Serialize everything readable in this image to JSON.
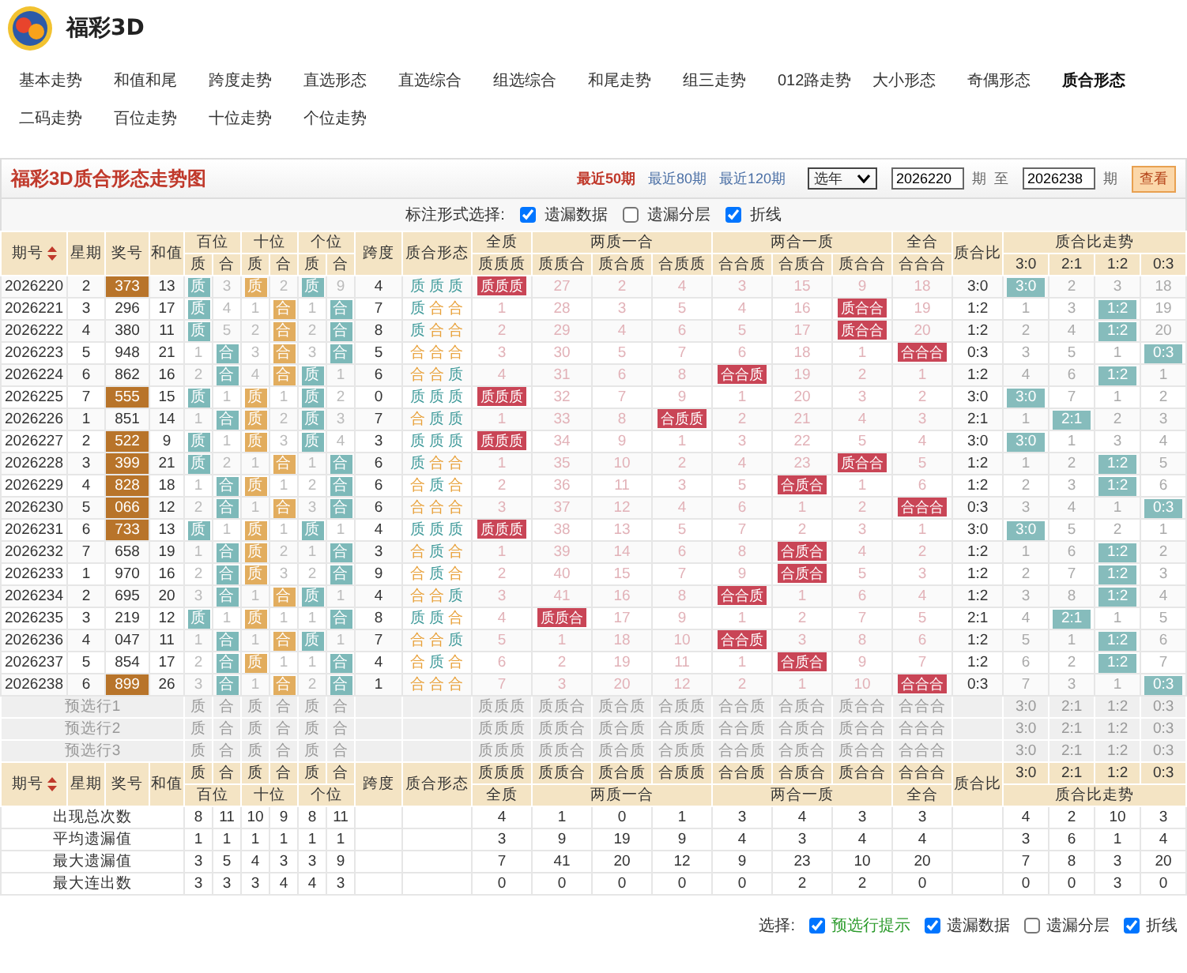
{
  "site": {
    "title": "福彩3D"
  },
  "nav": [
    {
      "label": "基本走势",
      "selected": false
    },
    {
      "label": "和值和尾",
      "selected": false
    },
    {
      "label": "跨度走势",
      "selected": false
    },
    {
      "label": "直选形态",
      "selected": false
    },
    {
      "label": "直选综合",
      "selected": false
    },
    {
      "label": "组选综合",
      "selected": false
    },
    {
      "label": "和尾走势",
      "selected": false
    },
    {
      "label": "组三走势",
      "selected": false
    },
    {
      "label": "012路走势",
      "selected": false
    },
    {
      "label": "大小形态",
      "selected": false
    },
    {
      "label": "奇偶形态",
      "selected": false
    },
    {
      "label": "质合形态",
      "selected": true
    },
    {
      "label": "二码走势",
      "selected": false
    },
    {
      "label": "百位走势",
      "selected": false
    },
    {
      "label": "十位走势",
      "selected": false
    },
    {
      "label": "个位走势",
      "selected": false
    }
  ],
  "chart_title": "福彩3D质合形态走势图",
  "period_links": [
    {
      "label": "最近50期",
      "selected": true
    },
    {
      "label": "最近80期",
      "selected": false
    },
    {
      "label": "最近120期",
      "selected": false
    }
  ],
  "year_select": {
    "value": "选年"
  },
  "range": {
    "from": "2026220",
    "from_unit": "期",
    "to_label": "至",
    "to": "2026238",
    "to_unit": "期",
    "button": "查看"
  },
  "marking": {
    "label": "标注形式选择:",
    "options": [
      {
        "label": "遗漏数据",
        "checked": true
      },
      {
        "label": "遗漏分层",
        "checked": false
      },
      {
        "label": "折线",
        "checked": true
      }
    ]
  },
  "header": {
    "basic": [
      "期号",
      "星期",
      "奖号",
      "和值"
    ],
    "digit_groups": [
      {
        "label": "百位",
        "sub": [
          "质",
          "合"
        ]
      },
      {
        "label": "十位",
        "sub": [
          "质",
          "合"
        ]
      },
      {
        "label": "个位",
        "sub": [
          "质",
          "合"
        ]
      }
    ],
    "span_label": "跨度",
    "form_label": "质合形态",
    "form_groups": [
      {
        "label": "全质",
        "sub": [
          "质质质"
        ]
      },
      {
        "label": "两质一合",
        "sub": [
          "质质合",
          "质合质",
          "合质质"
        ]
      },
      {
        "label": "两合一质",
        "sub": [
          "合合质",
          "合质合",
          "质合合"
        ]
      },
      {
        "label": "全合",
        "sub": [
          "合合合"
        ]
      }
    ],
    "ratio_label": "质合比",
    "trend_group": {
      "label": "质合比走势",
      "sub": [
        "3:0",
        "2:1",
        "1:2",
        "0:3"
      ]
    }
  },
  "rows": [
    {
      "period": "2026220",
      "weekday": "2",
      "number": "373",
      "highlighted": true,
      "sum": "13",
      "digits": [
        "质",
        "3",
        "质",
        "2",
        "质",
        "9"
      ],
      "digit_hits": [
        true,
        false,
        true,
        false,
        true,
        false
      ],
      "span": "4",
      "form": [
        {
          "text": "质",
          "color": "#3f9a9a"
        },
        {
          "text": "质",
          "color": "#3f9a9a"
        },
        {
          "text": "质",
          "color": "#3f9a9a"
        }
      ],
      "forms": [
        "质质质",
        "27",
        "2",
        "4",
        "3",
        "15",
        "9",
        "18"
      ],
      "form_hits": [
        true,
        false,
        false,
        false,
        false,
        false,
        false,
        false
      ],
      "ratio": "3:0",
      "trend": [
        "3:0",
        "2",
        "3",
        "18"
      ],
      "trend_hits": [
        true,
        false,
        false,
        false
      ]
    },
    {
      "period": "2026221",
      "weekday": "3",
      "number": "296",
      "highlighted": false,
      "sum": "17",
      "digits": [
        "质",
        "4",
        "1",
        "合",
        "1",
        "合"
      ],
      "digit_hits": [
        true,
        false,
        false,
        true,
        false,
        true
      ],
      "span": "7",
      "form": [
        {
          "text": "质",
          "color": "#3f9a9a"
        },
        {
          "text": "合",
          "color": "#e8a13a"
        },
        {
          "text": "合",
          "color": "#e8a13a"
        }
      ],
      "forms": [
        "1",
        "28",
        "3",
        "5",
        "4",
        "16",
        "质合合",
        "19"
      ],
      "form_hits": [
        false,
        false,
        false,
        false,
        false,
        false,
        true,
        false
      ],
      "ratio": "1:2",
      "trend": [
        "1",
        "3",
        "1:2",
        "19"
      ],
      "trend_hits": [
        false,
        false,
        true,
        false
      ]
    },
    {
      "period": "2026222",
      "weekday": "4",
      "number": "380",
      "highlighted": false,
      "sum": "11",
      "digits": [
        "质",
        "5",
        "2",
        "合",
        "2",
        "合"
      ],
      "digit_hits": [
        true,
        false,
        false,
        true,
        false,
        true
      ],
      "span": "8",
      "form": [
        {
          "text": "质",
          "color": "#3f9a9a"
        },
        {
          "text": "合",
          "color": "#e8a13a"
        },
        {
          "text": "合",
          "color": "#e8a13a"
        }
      ],
      "forms": [
        "2",
        "29",
        "4",
        "6",
        "5",
        "17",
        "质合合",
        "20"
      ],
      "form_hits": [
        false,
        false,
        false,
        false,
        false,
        false,
        true,
        false
      ],
      "ratio": "1:2",
      "trend": [
        "2",
        "4",
        "1:2",
        "20"
      ],
      "trend_hits": [
        false,
        false,
        true,
        false
      ]
    },
    {
      "period": "2026223",
      "weekday": "5",
      "number": "948",
      "highlighted": false,
      "sum": "21",
      "digits": [
        "1",
        "合",
        "3",
        "合",
        "3",
        "合"
      ],
      "digit_hits": [
        false,
        true,
        false,
        true,
        false,
        true
      ],
      "span": "5",
      "form": [
        {
          "text": "合",
          "color": "#e8a13a"
        },
        {
          "text": "合",
          "color": "#e8a13a"
        },
        {
          "text": "合",
          "color": "#e8a13a"
        }
      ],
      "forms": [
        "3",
        "30",
        "5",
        "7",
        "6",
        "18",
        "1",
        "合合合"
      ],
      "form_hits": [
        false,
        false,
        false,
        false,
        false,
        false,
        false,
        true
      ],
      "ratio": "0:3",
      "trend": [
        "3",
        "5",
        "1",
        "0:3"
      ],
      "trend_hits": [
        false,
        false,
        false,
        true
      ]
    },
    {
      "period": "2026224",
      "weekday": "6",
      "number": "862",
      "highlighted": false,
      "sum": "16",
      "digits": [
        "2",
        "合",
        "4",
        "合",
        "质",
        "1"
      ],
      "digit_hits": [
        false,
        true,
        false,
        true,
        true,
        false
      ],
      "span": "6",
      "form": [
        {
          "text": "合",
          "color": "#e8a13a"
        },
        {
          "text": "合",
          "color": "#e8a13a"
        },
        {
          "text": "质",
          "color": "#3f9a9a"
        }
      ],
      "forms": [
        "4",
        "31",
        "6",
        "8",
        "合合质",
        "19",
        "2",
        "1"
      ],
      "form_hits": [
        false,
        false,
        false,
        false,
        true,
        false,
        false,
        false
      ],
      "ratio": "1:2",
      "trend": [
        "4",
        "6",
        "1:2",
        "1"
      ],
      "trend_hits": [
        false,
        false,
        true,
        false
      ]
    },
    {
      "period": "2026225",
      "weekday": "7",
      "number": "555",
      "highlighted": true,
      "sum": "15",
      "digits": [
        "质",
        "1",
        "质",
        "1",
        "质",
        "2"
      ],
      "digit_hits": [
        true,
        false,
        true,
        false,
        true,
        false
      ],
      "span": "0",
      "form": [
        {
          "text": "质",
          "color": "#3f9a9a"
        },
        {
          "text": "质",
          "color": "#3f9a9a"
        },
        {
          "text": "质",
          "color": "#3f9a9a"
        }
      ],
      "forms": [
        "质质质",
        "32",
        "7",
        "9",
        "1",
        "20",
        "3",
        "2"
      ],
      "form_hits": [
        true,
        false,
        false,
        false,
        false,
        false,
        false,
        false
      ],
      "ratio": "3:0",
      "trend": [
        "3:0",
        "7",
        "1",
        "2"
      ],
      "trend_hits": [
        true,
        false,
        false,
        false
      ]
    },
    {
      "period": "2026226",
      "weekday": "1",
      "number": "851",
      "highlighted": false,
      "sum": "14",
      "digits": [
        "1",
        "合",
        "质",
        "2",
        "质",
        "3"
      ],
      "digit_hits": [
        false,
        true,
        true,
        false,
        true,
        false
      ],
      "span": "7",
      "form": [
        {
          "text": "合",
          "color": "#e8a13a"
        },
        {
          "text": "质",
          "color": "#3f9a9a"
        },
        {
          "text": "质",
          "color": "#3f9a9a"
        }
      ],
      "forms": [
        "1",
        "33",
        "8",
        "合质质",
        "2",
        "21",
        "4",
        "3"
      ],
      "form_hits": [
        false,
        false,
        false,
        true,
        false,
        false,
        false,
        false
      ],
      "ratio": "2:1",
      "trend": [
        "1",
        "2:1",
        "2",
        "3"
      ],
      "trend_hits": [
        false,
        true,
        false,
        false
      ]
    },
    {
      "period": "2026227",
      "weekday": "2",
      "number": "522",
      "highlighted": true,
      "sum": "9",
      "digits": [
        "质",
        "1",
        "质",
        "3",
        "质",
        "4"
      ],
      "digit_hits": [
        true,
        false,
        true,
        false,
        true,
        false
      ],
      "span": "3",
      "form": [
        {
          "text": "质",
          "color": "#3f9a9a"
        },
        {
          "text": "质",
          "color": "#3f9a9a"
        },
        {
          "text": "质",
          "color": "#3f9a9a"
        }
      ],
      "forms": [
        "质质质",
        "34",
        "9",
        "1",
        "3",
        "22",
        "5",
        "4"
      ],
      "form_hits": [
        true,
        false,
        false,
        false,
        false,
        false,
        false,
        false
      ],
      "ratio": "3:0",
      "trend": [
        "3:0",
        "1",
        "3",
        "4"
      ],
      "trend_hits": [
        true,
        false,
        false,
        false
      ]
    },
    {
      "period": "2026228",
      "weekday": "3",
      "number": "399",
      "highlighted": true,
      "sum": "21",
      "digits": [
        "质",
        "2",
        "1",
        "合",
        "1",
        "合"
      ],
      "digit_hits": [
        true,
        false,
        false,
        true,
        false,
        true
      ],
      "span": "6",
      "form": [
        {
          "text": "质",
          "color": "#3f9a9a"
        },
        {
          "text": "合",
          "color": "#e8a13a"
        },
        {
          "text": "合",
          "color": "#e8a13a"
        }
      ],
      "forms": [
        "1",
        "35",
        "10",
        "2",
        "4",
        "23",
        "质合合",
        "5"
      ],
      "form_hits": [
        false,
        false,
        false,
        false,
        false,
        false,
        true,
        false
      ],
      "ratio": "1:2",
      "trend": [
        "1",
        "2",
        "1:2",
        "5"
      ],
      "trend_hits": [
        false,
        false,
        true,
        false
      ]
    },
    {
      "period": "2026229",
      "weekday": "4",
      "number": "828",
      "highlighted": true,
      "sum": "18",
      "digits": [
        "1",
        "合",
        "质",
        "1",
        "2",
        "合"
      ],
      "digit_hits": [
        false,
        true,
        true,
        false,
        false,
        true
      ],
      "span": "6",
      "form": [
        {
          "text": "合",
          "color": "#e8a13a"
        },
        {
          "text": "质",
          "color": "#3f9a9a"
        },
        {
          "text": "合",
          "color": "#e8a13a"
        }
      ],
      "forms": [
        "2",
        "36",
        "11",
        "3",
        "5",
        "合质合",
        "1",
        "6"
      ],
      "form_hits": [
        false,
        false,
        false,
        false,
        false,
        true,
        false,
        false
      ],
      "ratio": "1:2",
      "trend": [
        "2",
        "3",
        "1:2",
        "6"
      ],
      "trend_hits": [
        false,
        false,
        true,
        false
      ]
    },
    {
      "period": "2026230",
      "weekday": "5",
      "number": "066",
      "highlighted": true,
      "sum": "12",
      "digits": [
        "2",
        "合",
        "1",
        "合",
        "3",
        "合"
      ],
      "digit_hits": [
        false,
        true,
        false,
        true,
        false,
        true
      ],
      "span": "6",
      "form": [
        {
          "text": "合",
          "color": "#e8a13a"
        },
        {
          "text": "合",
          "color": "#e8a13a"
        },
        {
          "text": "合",
          "color": "#e8a13a"
        }
      ],
      "forms": [
        "3",
        "37",
        "12",
        "4",
        "6",
        "1",
        "2",
        "合合合"
      ],
      "form_hits": [
        false,
        false,
        false,
        false,
        false,
        false,
        false,
        true
      ],
      "ratio": "0:3",
      "trend": [
        "3",
        "4",
        "1",
        "0:3"
      ],
      "trend_hits": [
        false,
        false,
        false,
        true
      ]
    },
    {
      "period": "2026231",
      "weekday": "6",
      "number": "733",
      "highlighted": true,
      "sum": "13",
      "digits": [
        "质",
        "1",
        "质",
        "1",
        "质",
        "1"
      ],
      "digit_hits": [
        true,
        false,
        true,
        false,
        true,
        false
      ],
      "span": "4",
      "form": [
        {
          "text": "质",
          "color": "#3f9a9a"
        },
        {
          "text": "质",
          "color": "#3f9a9a"
        },
        {
          "text": "质",
          "color": "#3f9a9a"
        }
      ],
      "forms": [
        "质质质",
        "38",
        "13",
        "5",
        "7",
        "2",
        "3",
        "1"
      ],
      "form_hits": [
        true,
        false,
        false,
        false,
        false,
        false,
        false,
        false
      ],
      "ratio": "3:0",
      "trend": [
        "3:0",
        "5",
        "2",
        "1"
      ],
      "trend_hits": [
        true,
        false,
        false,
        false
      ]
    },
    {
      "period": "2026232",
      "weekday": "7",
      "number": "658",
      "highlighted": false,
      "sum": "19",
      "digits": [
        "1",
        "合",
        "质",
        "2",
        "1",
        "合"
      ],
      "digit_hits": [
        false,
        true,
        true,
        false,
        false,
        true
      ],
      "span": "3",
      "form": [
        {
          "text": "合",
          "color": "#e8a13a"
        },
        {
          "text": "质",
          "color": "#3f9a9a"
        },
        {
          "text": "合",
          "color": "#e8a13a"
        }
      ],
      "forms": [
        "1",
        "39",
        "14",
        "6",
        "8",
        "合质合",
        "4",
        "2"
      ],
      "form_hits": [
        false,
        false,
        false,
        false,
        false,
        true,
        false,
        false
      ],
      "ratio": "1:2",
      "trend": [
        "1",
        "6",
        "1:2",
        "2"
      ],
      "trend_hits": [
        false,
        false,
        true,
        false
      ]
    },
    {
      "period": "2026233",
      "weekday": "1",
      "number": "970",
      "highlighted": false,
      "sum": "16",
      "digits": [
        "2",
        "合",
        "质",
        "3",
        "2",
        "合"
      ],
      "digit_hits": [
        false,
        true,
        true,
        false,
        false,
        true
      ],
      "span": "9",
      "form": [
        {
          "text": "合",
          "color": "#e8a13a"
        },
        {
          "text": "质",
          "color": "#3f9a9a"
        },
        {
          "text": "合",
          "color": "#e8a13a"
        }
      ],
      "forms": [
        "2",
        "40",
        "15",
        "7",
        "9",
        "合质合",
        "5",
        "3"
      ],
      "form_hits": [
        false,
        false,
        false,
        false,
        false,
        true,
        false,
        false
      ],
      "ratio": "1:2",
      "trend": [
        "2",
        "7",
        "1:2",
        "3"
      ],
      "trend_hits": [
        false,
        false,
        true,
        false
      ]
    },
    {
      "period": "2026234",
      "weekday": "2",
      "number": "695",
      "highlighted": false,
      "sum": "20",
      "digits": [
        "3",
        "合",
        "1",
        "合",
        "质",
        "1"
      ],
      "digit_hits": [
        false,
        true,
        false,
        true,
        true,
        false
      ],
      "span": "4",
      "form": [
        {
          "text": "合",
          "color": "#e8a13a"
        },
        {
          "text": "合",
          "color": "#e8a13a"
        },
        {
          "text": "质",
          "color": "#3f9a9a"
        }
      ],
      "forms": [
        "3",
        "41",
        "16",
        "8",
        "合合质",
        "1",
        "6",
        "4"
      ],
      "form_hits": [
        false,
        false,
        false,
        false,
        true,
        false,
        false,
        false
      ],
      "ratio": "1:2",
      "trend": [
        "3",
        "8",
        "1:2",
        "4"
      ],
      "trend_hits": [
        false,
        false,
        true,
        false
      ]
    },
    {
      "period": "2026235",
      "weekday": "3",
      "number": "219",
      "highlighted": false,
      "sum": "12",
      "digits": [
        "质",
        "1",
        "质",
        "1",
        "1",
        "合"
      ],
      "digit_hits": [
        true,
        false,
        true,
        false,
        false,
        true
      ],
      "span": "8",
      "form": [
        {
          "text": "质",
          "color": "#3f9a9a"
        },
        {
          "text": "质",
          "color": "#3f9a9a"
        },
        {
          "text": "合",
          "color": "#e8a13a"
        }
      ],
      "forms": [
        "4",
        "质质合",
        "17",
        "9",
        "1",
        "2",
        "7",
        "5"
      ],
      "form_hits": [
        false,
        true,
        false,
        false,
        false,
        false,
        false,
        false
      ],
      "ratio": "2:1",
      "trend": [
        "4",
        "2:1",
        "1",
        "5"
      ],
      "trend_hits": [
        false,
        true,
        false,
        false
      ]
    },
    {
      "period": "2026236",
      "weekday": "4",
      "number": "047",
      "highlighted": false,
      "sum": "11",
      "digits": [
        "1",
        "合",
        "1",
        "合",
        "质",
        "1"
      ],
      "digit_hits": [
        false,
        true,
        false,
        true,
        true,
        false
      ],
      "span": "7",
      "form": [
        {
          "text": "合",
          "color": "#e8a13a"
        },
        {
          "text": "合",
          "color": "#e8a13a"
        },
        {
          "text": "质",
          "color": "#3f9a9a"
        }
      ],
      "forms": [
        "5",
        "1",
        "18",
        "10",
        "合合质",
        "3",
        "8",
        "6"
      ],
      "form_hits": [
        false,
        false,
        false,
        false,
        true,
        false,
        false,
        false
      ],
      "ratio": "1:2",
      "trend": [
        "5",
        "1",
        "1:2",
        "6"
      ],
      "trend_hits": [
        false,
        false,
        true,
        false
      ]
    },
    {
      "period": "2026237",
      "weekday": "5",
      "number": "854",
      "highlighted": false,
      "sum": "17",
      "digits": [
        "2",
        "合",
        "质",
        "1",
        "1",
        "合"
      ],
      "digit_hits": [
        false,
        true,
        true,
        false,
        false,
        true
      ],
      "span": "4",
      "form": [
        {
          "text": "合",
          "color": "#e8a13a"
        },
        {
          "text": "质",
          "color": "#3f9a9a"
        },
        {
          "text": "合",
          "color": "#e8a13a"
        }
      ],
      "forms": [
        "6",
        "2",
        "19",
        "11",
        "1",
        "合质合",
        "9",
        "7"
      ],
      "form_hits": [
        false,
        false,
        false,
        false,
        false,
        true,
        false,
        false
      ],
      "ratio": "1:2",
      "trend": [
        "6",
        "2",
        "1:2",
        "7"
      ],
      "trend_hits": [
        false,
        false,
        true,
        false
      ]
    },
    {
      "period": "2026238",
      "weekday": "6",
      "number": "899",
      "highlighted": true,
      "sum": "26",
      "digits": [
        "3",
        "合",
        "1",
        "合",
        "2",
        "合"
      ],
      "digit_hits": [
        false,
        true,
        false,
        true,
        false,
        true
      ],
      "span": "1",
      "form": [
        {
          "text": "合",
          "color": "#e8a13a"
        },
        {
          "text": "合",
          "color": "#e8a13a"
        },
        {
          "text": "合",
          "color": "#e8a13a"
        }
      ],
      "forms": [
        "7",
        "3",
        "20",
        "12",
        "2",
        "1",
        "10",
        "合合合"
      ],
      "form_hits": [
        false,
        false,
        false,
        false,
        false,
        false,
        false,
        true
      ],
      "ratio": "0:3",
      "trend": [
        "7",
        "3",
        "1",
        "0:3"
      ],
      "trend_hits": [
        false,
        false,
        false,
        true
      ]
    }
  ],
  "preselect_rows": [
    {
      "label": "预选行1",
      "digits": [
        "质",
        "合",
        "质",
        "合",
        "质",
        "合"
      ],
      "forms": [
        "质质质",
        "质质合",
        "质合质",
        "合质质",
        "合合质",
        "合质合",
        "质合合",
        "合合合"
      ],
      "trend": [
        "3:0",
        "2:1",
        "1:2",
        "0:3"
      ]
    },
    {
      "label": "预选行2",
      "digits": [
        "质",
        "合",
        "质",
        "合",
        "质",
        "合"
      ],
      "forms": [
        "质质质",
        "质质合",
        "质合质",
        "合质质",
        "合合质",
        "合质合",
        "质合合",
        "合合合"
      ],
      "trend": [
        "3:0",
        "2:1",
        "1:2",
        "0:3"
      ]
    },
    {
      "label": "预选行3",
      "digits": [
        "质",
        "合",
        "质",
        "合",
        "质",
        "合"
      ],
      "forms": [
        "质质质",
        "质质合",
        "质合质",
        "合质质",
        "合合质",
        "合质合",
        "质合合",
        "合合合"
      ],
      "trend": [
        "3:0",
        "2:1",
        "1:2",
        "0:3"
      ]
    }
  ],
  "footer_header": {
    "basic": [
      "期号",
      "星期",
      "奖号",
      "和值"
    ],
    "digit_groups": [
      {
        "label": "百位",
        "sub": [
          "质",
          "合"
        ]
      },
      {
        "label": "十位",
        "sub": [
          "质",
          "合"
        ]
      },
      {
        "label": "个位",
        "sub": [
          "质",
          "合"
        ]
      }
    ],
    "span_label": "跨度",
    "form_label": "质合形态",
    "form_groups": [
      {
        "label": "全质",
        "sub": [
          "质质质"
        ]
      },
      {
        "label": "两质一合",
        "sub": [
          "质质合",
          "质合质",
          "合质质"
        ]
      },
      {
        "label": "两合一质",
        "sub": [
          "合合质",
          "合质合",
          "质合合"
        ]
      },
      {
        "label": "全合",
        "sub": [
          "合合合"
        ]
      }
    ],
    "ratio_label": "质合比",
    "trend_group": {
      "label": "质合比走势",
      "sub": [
        "3:0",
        "2:1",
        "1:2",
        "0:3"
      ]
    }
  },
  "stats": [
    {
      "label": "出现总次数",
      "digits": [
        "8",
        "11",
        "10",
        "9",
        "8",
        "11"
      ],
      "forms": [
        "4",
        "1",
        "0",
        "1",
        "3",
        "4",
        "3",
        "3"
      ],
      "trend": [
        "4",
        "2",
        "10",
        "3"
      ]
    },
    {
      "label": "平均遗漏值",
      "digits": [
        "1",
        "1",
        "1",
        "1",
        "1",
        "1"
      ],
      "forms": [
        "3",
        "9",
        "19",
        "9",
        "4",
        "3",
        "4",
        "4"
      ],
      "trend": [
        "3",
        "6",
        "1",
        "4"
      ]
    },
    {
      "label": "最大遗漏值",
      "digits": [
        "3",
        "5",
        "4",
        "3",
        "3",
        "9"
      ],
      "forms": [
        "7",
        "41",
        "20",
        "12",
        "9",
        "23",
        "10",
        "20"
      ],
      "trend": [
        "7",
        "8",
        "3",
        "20"
      ]
    },
    {
      "label": "最大连出数",
      "digits": [
        "3",
        "3",
        "3",
        "4",
        "4",
        "3"
      ],
      "forms": [
        "0",
        "0",
        "0",
        "0",
        "0",
        "2",
        "2",
        "0"
      ],
      "trend": [
        "0",
        "0",
        "3",
        "0"
      ]
    }
  ],
  "footer": {
    "label": "选择:",
    "options": [
      {
        "label": "预选行提示",
        "checked": true,
        "color": "#2a9a2a"
      },
      {
        "label": "遗漏数据",
        "checked": true,
        "color": "#333333"
      },
      {
        "label": "遗漏分层",
        "checked": false,
        "color": "#333333"
      },
      {
        "label": "折线",
        "checked": true,
        "color": "#333333"
      }
    ]
  }
}
